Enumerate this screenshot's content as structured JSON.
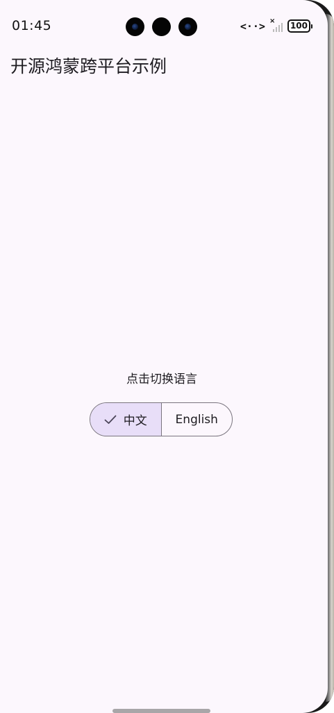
{
  "status_bar": {
    "time": "01:45",
    "battery": "100",
    "signal_mark": "×",
    "network_icon": "code-brackets-icon"
  },
  "app": {
    "title": "开源鸿蒙跨平台示例"
  },
  "main": {
    "hint": "点击切换语言",
    "language_toggle": {
      "options": [
        {
          "label": "中文",
          "selected": true
        },
        {
          "label": "English",
          "selected": false
        }
      ]
    }
  },
  "colors": {
    "background": "#fcf7fd",
    "selected_segment": "#e8def8",
    "outline": "#79747e",
    "text": "#1d1b20"
  }
}
